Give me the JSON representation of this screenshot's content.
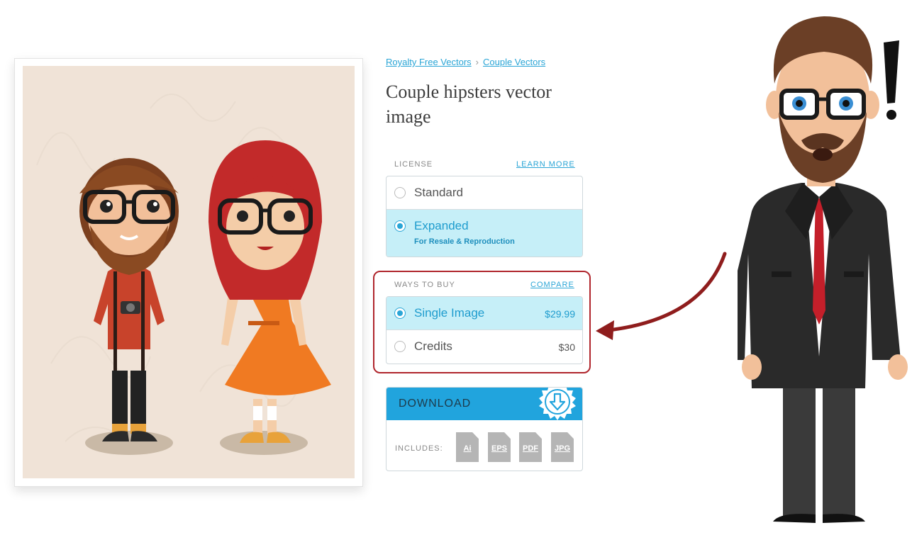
{
  "breadcrumb": {
    "items": [
      "Royalty Free Vectors",
      "Couple Vectors"
    ],
    "separator": "›"
  },
  "product": {
    "title": "Couple hipsters vector image"
  },
  "license": {
    "heading": "LICENSE",
    "learn_more": "LEARN MORE",
    "options": [
      {
        "label": "Standard",
        "selected": false
      },
      {
        "label": "Expanded",
        "sublabel": "For Resale & Reproduction",
        "selected": true
      }
    ]
  },
  "ways_to_buy": {
    "heading": "WAYS TO BUY",
    "compare": "COMPARE",
    "options": [
      {
        "label": "Single Image",
        "price": "$29.99",
        "selected": true
      },
      {
        "label": "Credits",
        "price": "$30",
        "selected": false
      }
    ]
  },
  "download": {
    "button_label": "DOWNLOAD",
    "includes_label": "INCLUDES:",
    "file_types": [
      "Ai",
      "EPS",
      "PDF",
      "JPG"
    ]
  },
  "annotation": {
    "exclamation": "!"
  },
  "colors": {
    "accent": "#21a4dd",
    "selected_bg": "#c6eff8",
    "highlight": "#b0262d",
    "preview_bg": "#f0e3d7"
  }
}
